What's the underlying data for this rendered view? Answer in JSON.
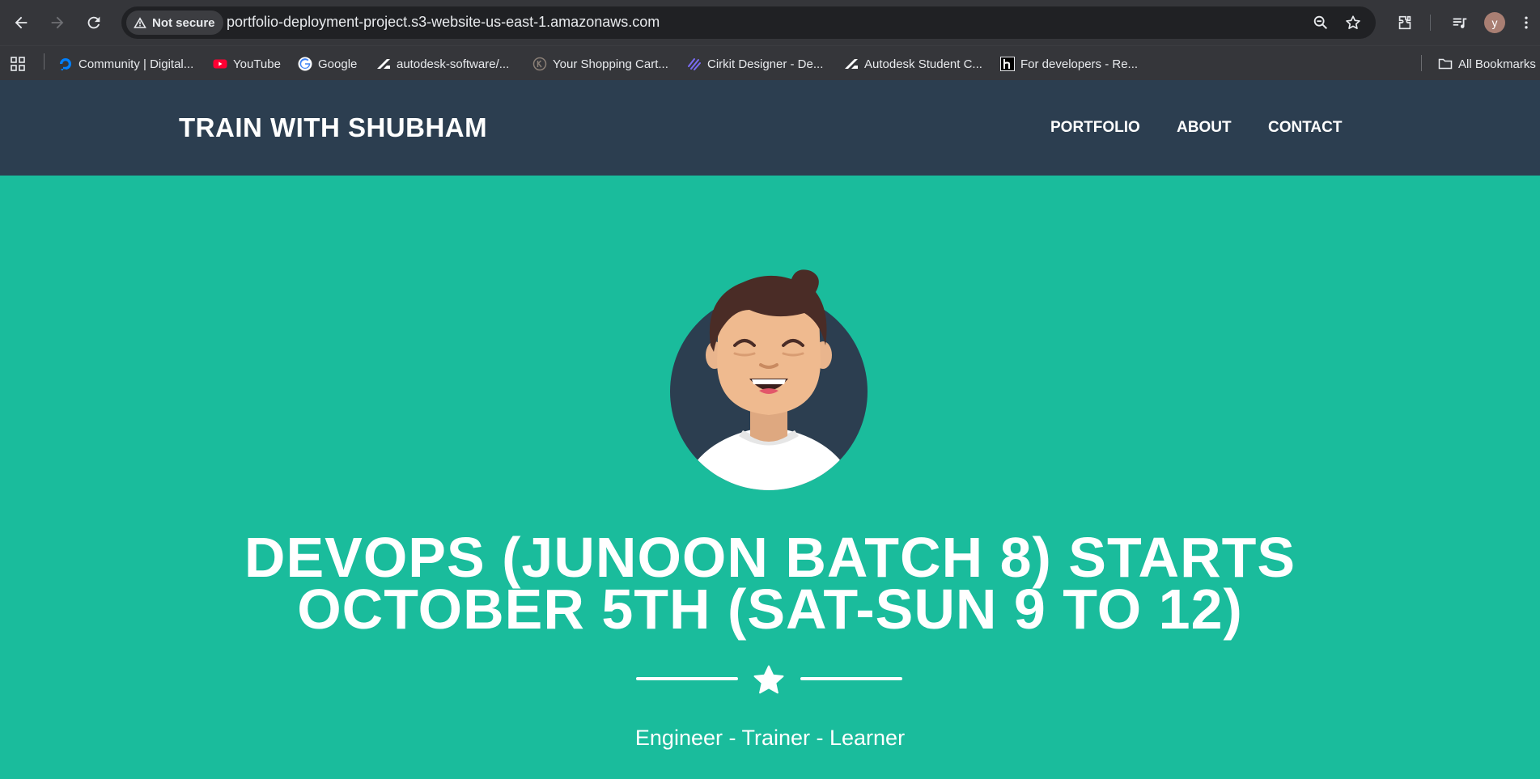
{
  "browser": {
    "security_label": "Not secure",
    "url": "portfolio-deployment-project.s3-website-us-east-1.amazonaws.com",
    "profile_initial": "y",
    "bookmarks": [
      {
        "label": "Community | Digital...",
        "icon": "digitalocean-icon"
      },
      {
        "label": "YouTube",
        "icon": "youtube-icon"
      },
      {
        "label": "Google",
        "icon": "google-icon"
      },
      {
        "label": "autodesk-software/...",
        "icon": "autodesk-icon"
      },
      {
        "label": "Your Shopping Cart...",
        "icon": "shopping-cart-site-icon"
      },
      {
        "label": "Cirkit Designer - De...",
        "icon": "cirkit-icon"
      },
      {
        "label": "Autodesk Student C...",
        "icon": "autodesk-icon"
      },
      {
        "label": "For developers - Re...",
        "icon": "h-logo-icon"
      }
    ],
    "all_bookmarks_label": "All Bookmarks"
  },
  "site": {
    "brand": "TRAIN WITH SHUBHAM",
    "nav": [
      {
        "label": "PORTFOLIO"
      },
      {
        "label": "ABOUT"
      },
      {
        "label": "CONTACT"
      }
    ],
    "headline_line1": "DEVOPS (JUNOON BATCH 8) STARTS",
    "headline_line2": "OCTOBER 5TH (SAT-SUN 9 TO 12)",
    "subtitle": "Engineer - Trainer - Learner"
  },
  "colors": {
    "nav_bg": "#2c3e50",
    "hero_bg": "#1abc9c",
    "chrome_bg": "#35363a"
  }
}
